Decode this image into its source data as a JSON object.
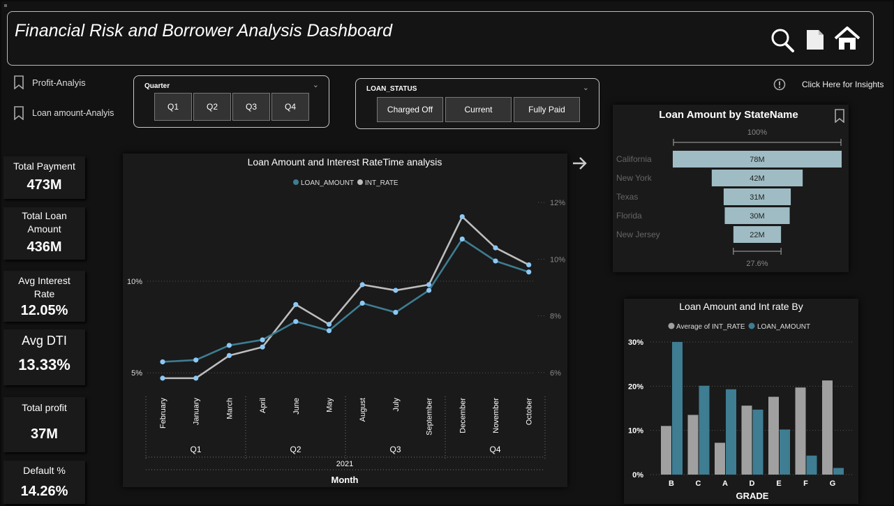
{
  "header": {
    "title": "Financial Risk and Borrower Analysis Dashboard"
  },
  "nav": {
    "items": [
      {
        "label": "Profit-Analyis"
      },
      {
        "label": "Loan amount-Analyis"
      }
    ],
    "insights_label": "Click Here for Insights"
  },
  "slicers": {
    "quarter": {
      "label": "Quarter",
      "options": [
        "Q1",
        "Q2",
        "Q3",
        "Q4"
      ]
    },
    "loan_status": {
      "label": "LOAN_STATUS",
      "options": [
        "Charged Off",
        "Current",
        "Fully Paid"
      ]
    }
  },
  "kpis": [
    {
      "label": "Total Payment",
      "value": "473M"
    },
    {
      "label": "Total Loan Amount",
      "value": "436M"
    },
    {
      "label": "Avg Interest Rate",
      "value": "12.05%"
    },
    {
      "label": "Avg DTI",
      "value": "13.33%"
    },
    {
      "label": "Total profit",
      "value": "37M"
    },
    {
      "label": "Default %",
      "value": "14.26%"
    }
  ],
  "colors": {
    "loan_amount": "#3e7d92",
    "int_rate": "#bdbdbd",
    "marker": "#8cc8f5",
    "funnel": "#9fbcc4",
    "bar_grey": "#a0a0a0"
  },
  "chart_data": [
    {
      "type": "line",
      "title": "Loan Amount and Interest RateTime analysis",
      "xlabel": "Month",
      "x_hierarchy": {
        "year": "2021",
        "quarters": [
          "Q1",
          "Q2",
          "Q3",
          "Q4"
        ]
      },
      "categories": [
        "February",
        "January",
        "March",
        "April",
        "June",
        "May",
        "August",
        "July",
        "September",
        "December",
        "November",
        "October"
      ],
      "quarter_of_category": [
        "Q1",
        "Q1",
        "Q1",
        "Q2",
        "Q2",
        "Q2",
        "Q3",
        "Q3",
        "Q3",
        "Q4",
        "Q4",
        "Q4"
      ],
      "series": [
        {
          "name": "LOAN_AMOUNT",
          "axis": "left",
          "values": [
            5.6,
            5.7,
            6.5,
            6.8,
            7.8,
            7.3,
            8.8,
            8.3,
            9.5,
            12.3,
            11.1,
            10.5
          ]
        },
        {
          "name": "INT_RATE",
          "axis": "right",
          "values": [
            5.8,
            5.8,
            6.6,
            6.9,
            8.4,
            7.7,
            9.1,
            8.9,
            9.1,
            11.5,
            10.4,
            9.8
          ]
        }
      ],
      "left_axis": {
        "ticks": [
          "5%",
          "10%"
        ],
        "tick_values": [
          5,
          10
        ],
        "range": [
          4.4,
          14.6
        ]
      },
      "right_axis": {
        "ticks": [
          "12%",
          "10%",
          "8%",
          "6%"
        ],
        "tick_values": [
          12,
          10,
          8,
          6
        ],
        "range": [
          5.6,
          12.2
        ]
      },
      "legend": "top-center"
    },
    {
      "type": "bar",
      "title": "Loan Amount by StateName",
      "top_label": "100%",
      "bottom_label": "27.6%",
      "categories": [
        "California",
        "New York",
        "Texas",
        "Florida",
        "New Jersey"
      ],
      "values": [
        78,
        42,
        31,
        30,
        22
      ],
      "value_labels": [
        "78M",
        "42M",
        "31M",
        "30M",
        "22M"
      ]
    },
    {
      "type": "bar",
      "title": "Loan Amount and Int rate By",
      "xlabel": "GRADE",
      "categories": [
        "B",
        "C",
        "A",
        "D",
        "E",
        "F",
        "G"
      ],
      "series": [
        {
          "name": "Average of INT_RATE",
          "values": [
            11,
            13.5,
            7.2,
            15.6,
            17.6,
            19.7,
            21.3
          ]
        },
        {
          "name": "LOAN_AMOUNT",
          "values": [
            30,
            20.1,
            19.3,
            14.7,
            10.2,
            4.3,
            1.5
          ]
        }
      ],
      "y_ticks": [
        "30%",
        "20%",
        "10%",
        "0%"
      ],
      "ylim": [
        0,
        30
      ],
      "legend": "top-center"
    }
  ]
}
